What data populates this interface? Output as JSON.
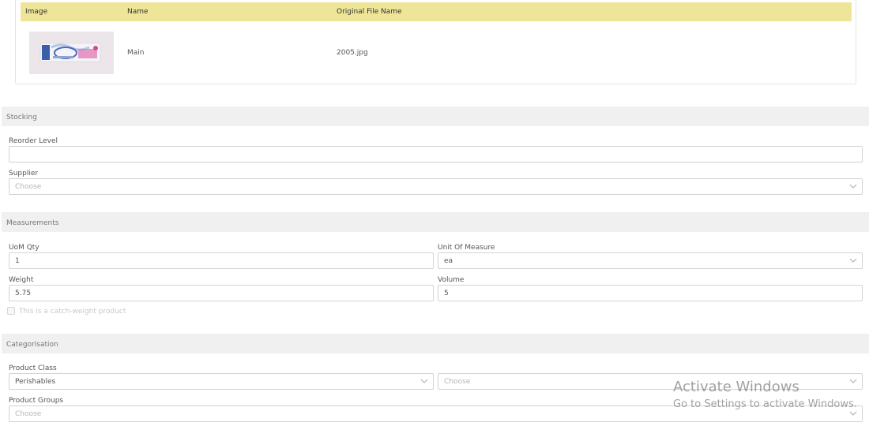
{
  "images_table": {
    "headers": {
      "image": "Image",
      "name": "Name",
      "original_file_name": "Original File Name"
    },
    "rows": [
      {
        "name": "Main",
        "original_file_name": "2005.jpg"
      }
    ]
  },
  "stocking": {
    "title": "Stocking",
    "reorder_level": {
      "label": "Reorder Level",
      "value": ""
    },
    "supplier": {
      "label": "Supplier",
      "placeholder": "Choose"
    }
  },
  "measurements": {
    "title": "Measurements",
    "uom_qty": {
      "label": "UoM Qty",
      "value": "1"
    },
    "unit_of_measure": {
      "label": "Unit Of Measure",
      "value": "ea"
    },
    "weight": {
      "label": "Weight",
      "value": "5.75"
    },
    "volume": {
      "label": "Volume",
      "value": "5"
    },
    "catch_weight": {
      "label": "This is a catch-weight product",
      "checked": false
    }
  },
  "categorisation": {
    "title": "Categorisation",
    "product_class": {
      "label": "Product Class",
      "value": "Perishables",
      "sub_placeholder": "Choose"
    },
    "product_groups": {
      "label": "Product Groups",
      "placeholder": "Choose"
    }
  },
  "watermark": {
    "line1": "Activate Windows",
    "line2": "Go to Settings to activate Windows."
  },
  "colors": {
    "table_header": "#efe598",
    "section_bg": "#f0f0f0",
    "border": "#d3d3d3"
  }
}
